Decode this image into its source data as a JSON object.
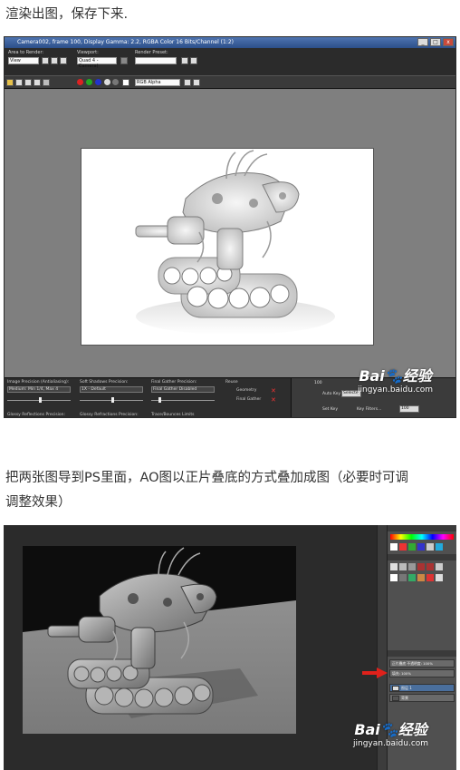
{
  "article": {
    "paragraph_1": "渲染出图，保存下来.",
    "paragraph_2_line1": "把两张图导到PS里面，AO图以正片叠底的方式叠加成图（必要时可调",
    "paragraph_2_line2": "调整效果）"
  },
  "render_window": {
    "title": "Camera002, frame 100, Display Gamma: 2.2, RGBA Color 16 Bits/Channel (1:2)",
    "area_to_render_label": "Area to Render:",
    "area_to_render_value": "View",
    "viewport_label": "Viewport:",
    "viewport_value": "Quad 4 - Camera(",
    "render_preset_label": "Render Preset:",
    "render_preset_value": "",
    "channel_value": "RGB Alpha",
    "image_precision_label": "Image Precision (Antialiasing):",
    "image_precision_value": "Medium: Min 1/4, Max 4",
    "soft_shadows_label": "Soft Shadows Precision:",
    "soft_shadows_value": "1X - Default",
    "final_gather_label": "Final Gather Precision:",
    "final_gather_value": "Final Gather Disabled",
    "reuse_label": "Reuse",
    "geometry_label": "Geometry",
    "final_gather_check_label": "Final Gather",
    "glossy_reflections_label": "Glossy Reflections Precision:",
    "glossy_refractions_label": "Glossy Refractions Precision:",
    "trace_bounces_label": "Trace/Bounces Limits",
    "frame_number": "100",
    "auto_key_label": "Auto Key",
    "auto_key_value": "Selecte",
    "set_key_label": "Set Key",
    "key_filters_label": "Key Filters...",
    "time_value": "100",
    "win_minimize": "_",
    "win_maximize": "□",
    "win_close": "x"
  },
  "photoshop": {
    "layer_blend_mode": "正片叠底",
    "layer_opacity": "不透明度: 100%",
    "layer_fill": "填充: 100%",
    "layer_1_name": "图层 1",
    "layer_2_name": "背景"
  },
  "watermark": {
    "logo": "Bai",
    "logo_tail": "经验",
    "url": "jingyan.baidu.com"
  },
  "colors": {
    "annotation_arrow": "#e0211b",
    "ps_layer_highlight": "#4a6f9d"
  },
  "icons": [
    "render-button-icon",
    "paw-logo-icon",
    "red-arrow-icon"
  ]
}
